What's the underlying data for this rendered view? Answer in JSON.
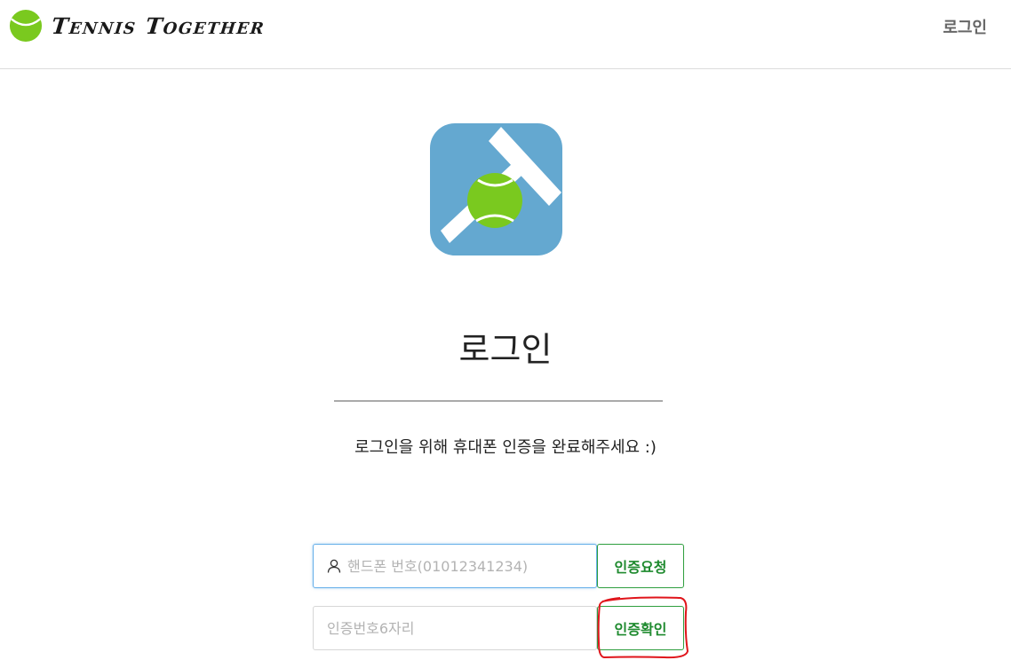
{
  "header": {
    "brand_name": "Tennis Together",
    "brand_icon": "tennis-ball-icon",
    "login_link": "로그인"
  },
  "main": {
    "logo_icon": "tennis-racket-ball-app-icon",
    "title": "로그인",
    "subtitle": "로그인을 위해 휴대폰 인증을 완료해주세요 :)"
  },
  "form": {
    "phone": {
      "placeholder": "핸드폰 번호(01012341234)",
      "value": "",
      "icon": "user-icon"
    },
    "request_button": "인증요청",
    "code": {
      "placeholder": "인증번호6자리",
      "value": ""
    },
    "confirm_button": "인증확인"
  },
  "colors": {
    "brand_green": "#7ac91f",
    "logo_bg": "#64a8d0",
    "button_green": "#1e8a2e",
    "annotation_red": "#e0151b"
  }
}
